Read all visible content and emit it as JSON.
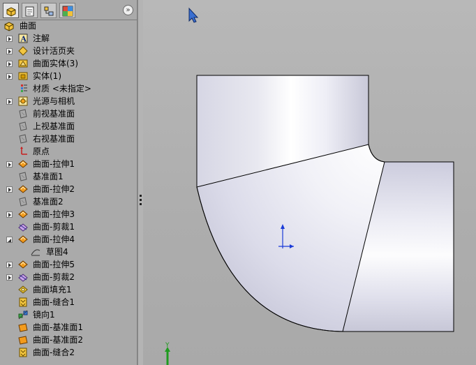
{
  "tabs": [
    {
      "name": "feature-manager"
    },
    {
      "name": "property-manager"
    },
    {
      "name": "configuration-manager"
    },
    {
      "name": "display-manager"
    }
  ],
  "collapse_glyph": "»",
  "tree": {
    "root": {
      "label": "曲面",
      "icon": "part-icon"
    },
    "items": [
      {
        "label": "注解",
        "icon": "annotations-icon",
        "expander": "collapsed"
      },
      {
        "label": "设计活页夹",
        "icon": "design-binder-icon",
        "expander": "collapsed"
      },
      {
        "label": "曲面实体(3)",
        "icon": "surface-bodies-icon",
        "expander": "collapsed"
      },
      {
        "label": "实体(1)",
        "icon": "solid-bodies-icon",
        "expander": "collapsed"
      },
      {
        "label": "材质 <未指定>",
        "icon": "material-icon",
        "expander": "none"
      },
      {
        "label": "光源与相机",
        "icon": "lights-cameras-icon",
        "expander": "collapsed"
      },
      {
        "label": "前视基准面",
        "icon": "plane-icon",
        "expander": "none"
      },
      {
        "label": "上视基准面",
        "icon": "plane-icon",
        "expander": "none"
      },
      {
        "label": "右视基准面",
        "icon": "plane-icon",
        "expander": "none"
      },
      {
        "label": "原点",
        "icon": "origin-icon",
        "expander": "none"
      },
      {
        "label": "曲面-拉伸1",
        "icon": "surface-extrude-icon",
        "expander": "collapsed"
      },
      {
        "label": "基准面1",
        "icon": "plane-icon",
        "expander": "none"
      },
      {
        "label": "曲面-拉伸2",
        "icon": "surface-extrude-icon",
        "expander": "collapsed"
      },
      {
        "label": "基准面2",
        "icon": "plane-icon",
        "expander": "none"
      },
      {
        "label": "曲面-拉伸3",
        "icon": "surface-extrude-icon",
        "expander": "collapsed"
      },
      {
        "label": "曲面-剪裁1",
        "icon": "surface-trim-icon",
        "expander": "none"
      },
      {
        "label": "曲面-拉伸4",
        "icon": "surface-extrude-icon",
        "expander": "expanded"
      },
      {
        "label": "草图4",
        "icon": "sketch-icon",
        "expander": "none",
        "child": true
      },
      {
        "label": "曲面-拉伸5",
        "icon": "surface-extrude-icon",
        "expander": "collapsed"
      },
      {
        "label": "曲面-剪裁2",
        "icon": "surface-trim-icon",
        "expander": "collapsed"
      },
      {
        "label": "曲面填充1",
        "icon": "surface-fill-icon",
        "expander": "none"
      },
      {
        "label": "曲面-缝合1",
        "icon": "surface-knit-icon",
        "expander": "none"
      },
      {
        "label": "镜向1",
        "icon": "mirror-icon",
        "expander": "none"
      },
      {
        "label": "曲面-基准面1",
        "icon": "planar-surface-icon",
        "expander": "none"
      },
      {
        "label": "曲面-基准面2",
        "icon": "planar-surface-icon",
        "expander": "none"
      },
      {
        "label": "曲面-缝合2",
        "icon": "surface-knit-icon",
        "expander": "none"
      }
    ]
  },
  "viewport": {
    "triad_axis_label": "Y",
    "background": "#aeaeae",
    "model_color": "#dcdcec"
  }
}
